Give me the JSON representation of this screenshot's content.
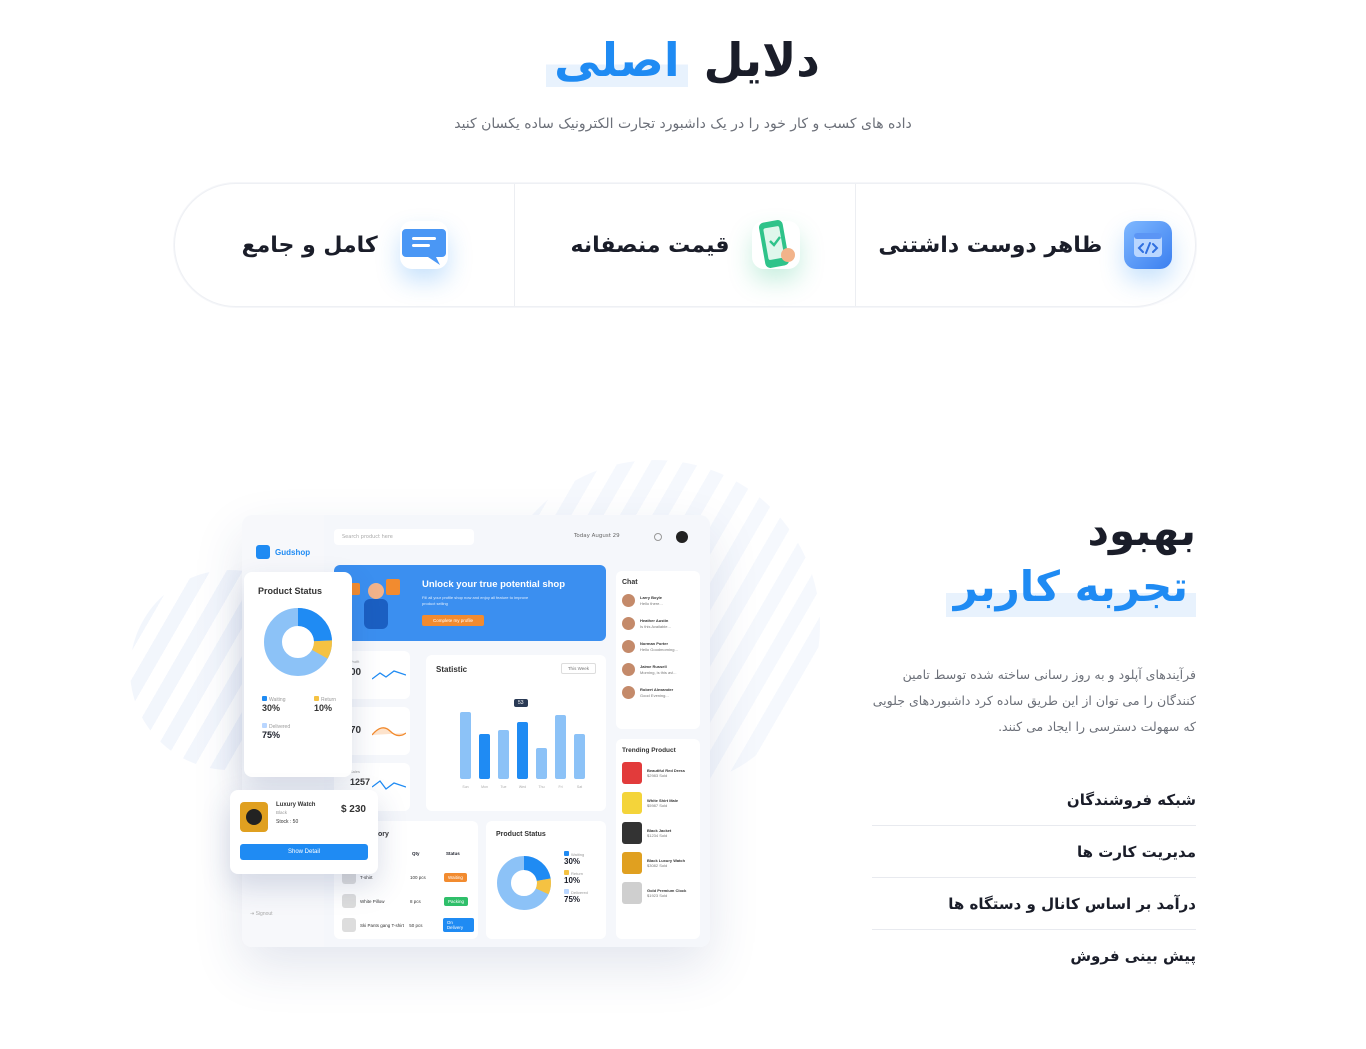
{
  "hero": {
    "title_dark": "دلایل",
    "title_blue": "اصلی",
    "subtitle": "داده های کسب و کار خود را در یک داشبورد تجارت الکترونیک ساده یکسان کنید"
  },
  "features": [
    {
      "label": "ظاهر دوست داشتنی",
      "icon": "code-window-icon"
    },
    {
      "label": "قیمت منصفانه",
      "icon": "mobile-payment-icon"
    },
    {
      "label": "کامل و جامع",
      "icon": "chat-bubble-icon"
    }
  ],
  "ux": {
    "title_line1": "بهبود",
    "title_line2": "تجربه کاربر",
    "description": "فرآیندهای آپلود و به روز رسانی ساخته شده توسط تامین کنندگان را می توان از این طریق ساده کرد داشبوردهای جلویی که سهولت دسترسی را ایجاد می کنند.",
    "items": [
      "شبکه فروشندگان",
      "مدیریت کارت ها",
      "درآمد بر اساس کانال و دستگاه ها",
      "پیش بینی فروش"
    ]
  },
  "dashboard": {
    "brand": "Gudshop",
    "search_placeholder": "Search product here",
    "date_label": "Today August 29",
    "banner_title": "Unlock your true potential shop",
    "banner_desc": "Fill all your profile shop now and enjoy all feature to improve product selling",
    "banner_button": "Complete my profile",
    "statistic_title": "Statistic",
    "statistic_filter": "This Week",
    "statistic_badge": "53",
    "statistic_values": [
      0.78,
      0.52,
      0.57,
      0.66,
      0.36,
      0.74,
      0.52
    ],
    "statistic_days": [
      "Sun",
      "Mon",
      "Tue",
      "Wed",
      "Thu",
      "Fri",
      "Sat"
    ],
    "chat_title": "Chat",
    "chat": [
      {
        "name": "Larry Boyle",
        "msg": "Hello there..."
      },
      {
        "name": "Heather Austin",
        "msg": "Is this Available..."
      },
      {
        "name": "Norman Porter",
        "msg": "Hello Goodmorning..."
      },
      {
        "name": "Jaime Russell",
        "msg": "Morning, is this avl..."
      },
      {
        "name": "Robert Alexander",
        "msg": "Good Evening..."
      }
    ],
    "trending_title": "Trending Product",
    "trending": [
      {
        "name": "Beautiful Red Dress",
        "sold": "$2983 Sold",
        "color": "#e23b3b"
      },
      {
        "name": "White Shirt Male",
        "sold": "$5987 Sold",
        "color": "#f4d43a"
      },
      {
        "name": "Black Jacket",
        "sold": "$1234 Sold",
        "color": "#333333"
      },
      {
        "name": "Black Luxury Watch",
        "sold": "$3082 Sold",
        "color": "#e0a020"
      },
      {
        "name": "Gold Premium Clock",
        "sold": "$1923 Sold",
        "color": "#cfcfcf"
      }
    ],
    "product_status_title": "Product Status",
    "status": {
      "waiting_label": "Waiting",
      "waiting": "30%",
      "return_label": "Return",
      "return": "10%",
      "delivered_label": "Delivered",
      "delivered": "75%"
    },
    "inventory_title": "ory",
    "inventory_headers": [
      "Qty",
      "Status"
    ],
    "inventory": [
      {
        "item": "T-shirt",
        "qty": "100 pcs",
        "status": "Waiting",
        "color": "#f28b2f"
      },
      {
        "item": "White Pillow",
        "qty": "8 pcs",
        "status": "Packing",
        "color": "#2fbf6a"
      },
      {
        "item": "Ski Pants gang T-shirt",
        "qty": "50 pcs",
        "status": "On Delivery",
        "color": "#1f8bf3"
      }
    ],
    "mini_cards": [
      {
        "label": "Profit",
        "value": "00"
      },
      {
        "label": "",
        "value": "70"
      },
      {
        "label": "Sales",
        "value": "1257"
      }
    ],
    "watch_name": "Luxury Watch",
    "watch_color": "Black",
    "watch_stock": "Stock : 50",
    "watch_price": "$ 230",
    "watch_button": "Show Detail",
    "signout": "Signout"
  }
}
